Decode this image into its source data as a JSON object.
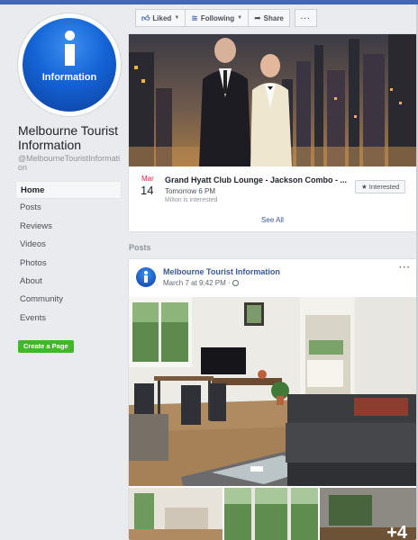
{
  "page": {
    "avatar_text": "Information",
    "name": "Melbourne Tourist Information",
    "handle": "@MelbourneTouristInformation"
  },
  "nav": [
    "Home",
    "Posts",
    "Reviews",
    "Videos",
    "Photos",
    "About",
    "Community",
    "Events"
  ],
  "nav_active": "Home",
  "create_page_label": "Create a Page",
  "actions": {
    "liked": "Liked",
    "following": "Following",
    "share": "Share",
    "more": "···"
  },
  "event": {
    "month": "Mar",
    "day": "14",
    "title": "Grand Hyatt Club Lounge - Jackson Combo - ...",
    "time": "Tomorrow 6 PM",
    "interest": "Milton is interested",
    "interested_label": "★ Interested",
    "see_all": "See All"
  },
  "posts_section_label": "Posts",
  "post": {
    "author": "Melbourne Tourist Information",
    "time": "March 7 at 9:42 PM ·",
    "more": "···",
    "extra_photos": "+4"
  },
  "colors": {
    "brand_blue": "#4267b2",
    "link_blue": "#385898",
    "create_green": "#42b72a",
    "date_red": "#f02849"
  }
}
